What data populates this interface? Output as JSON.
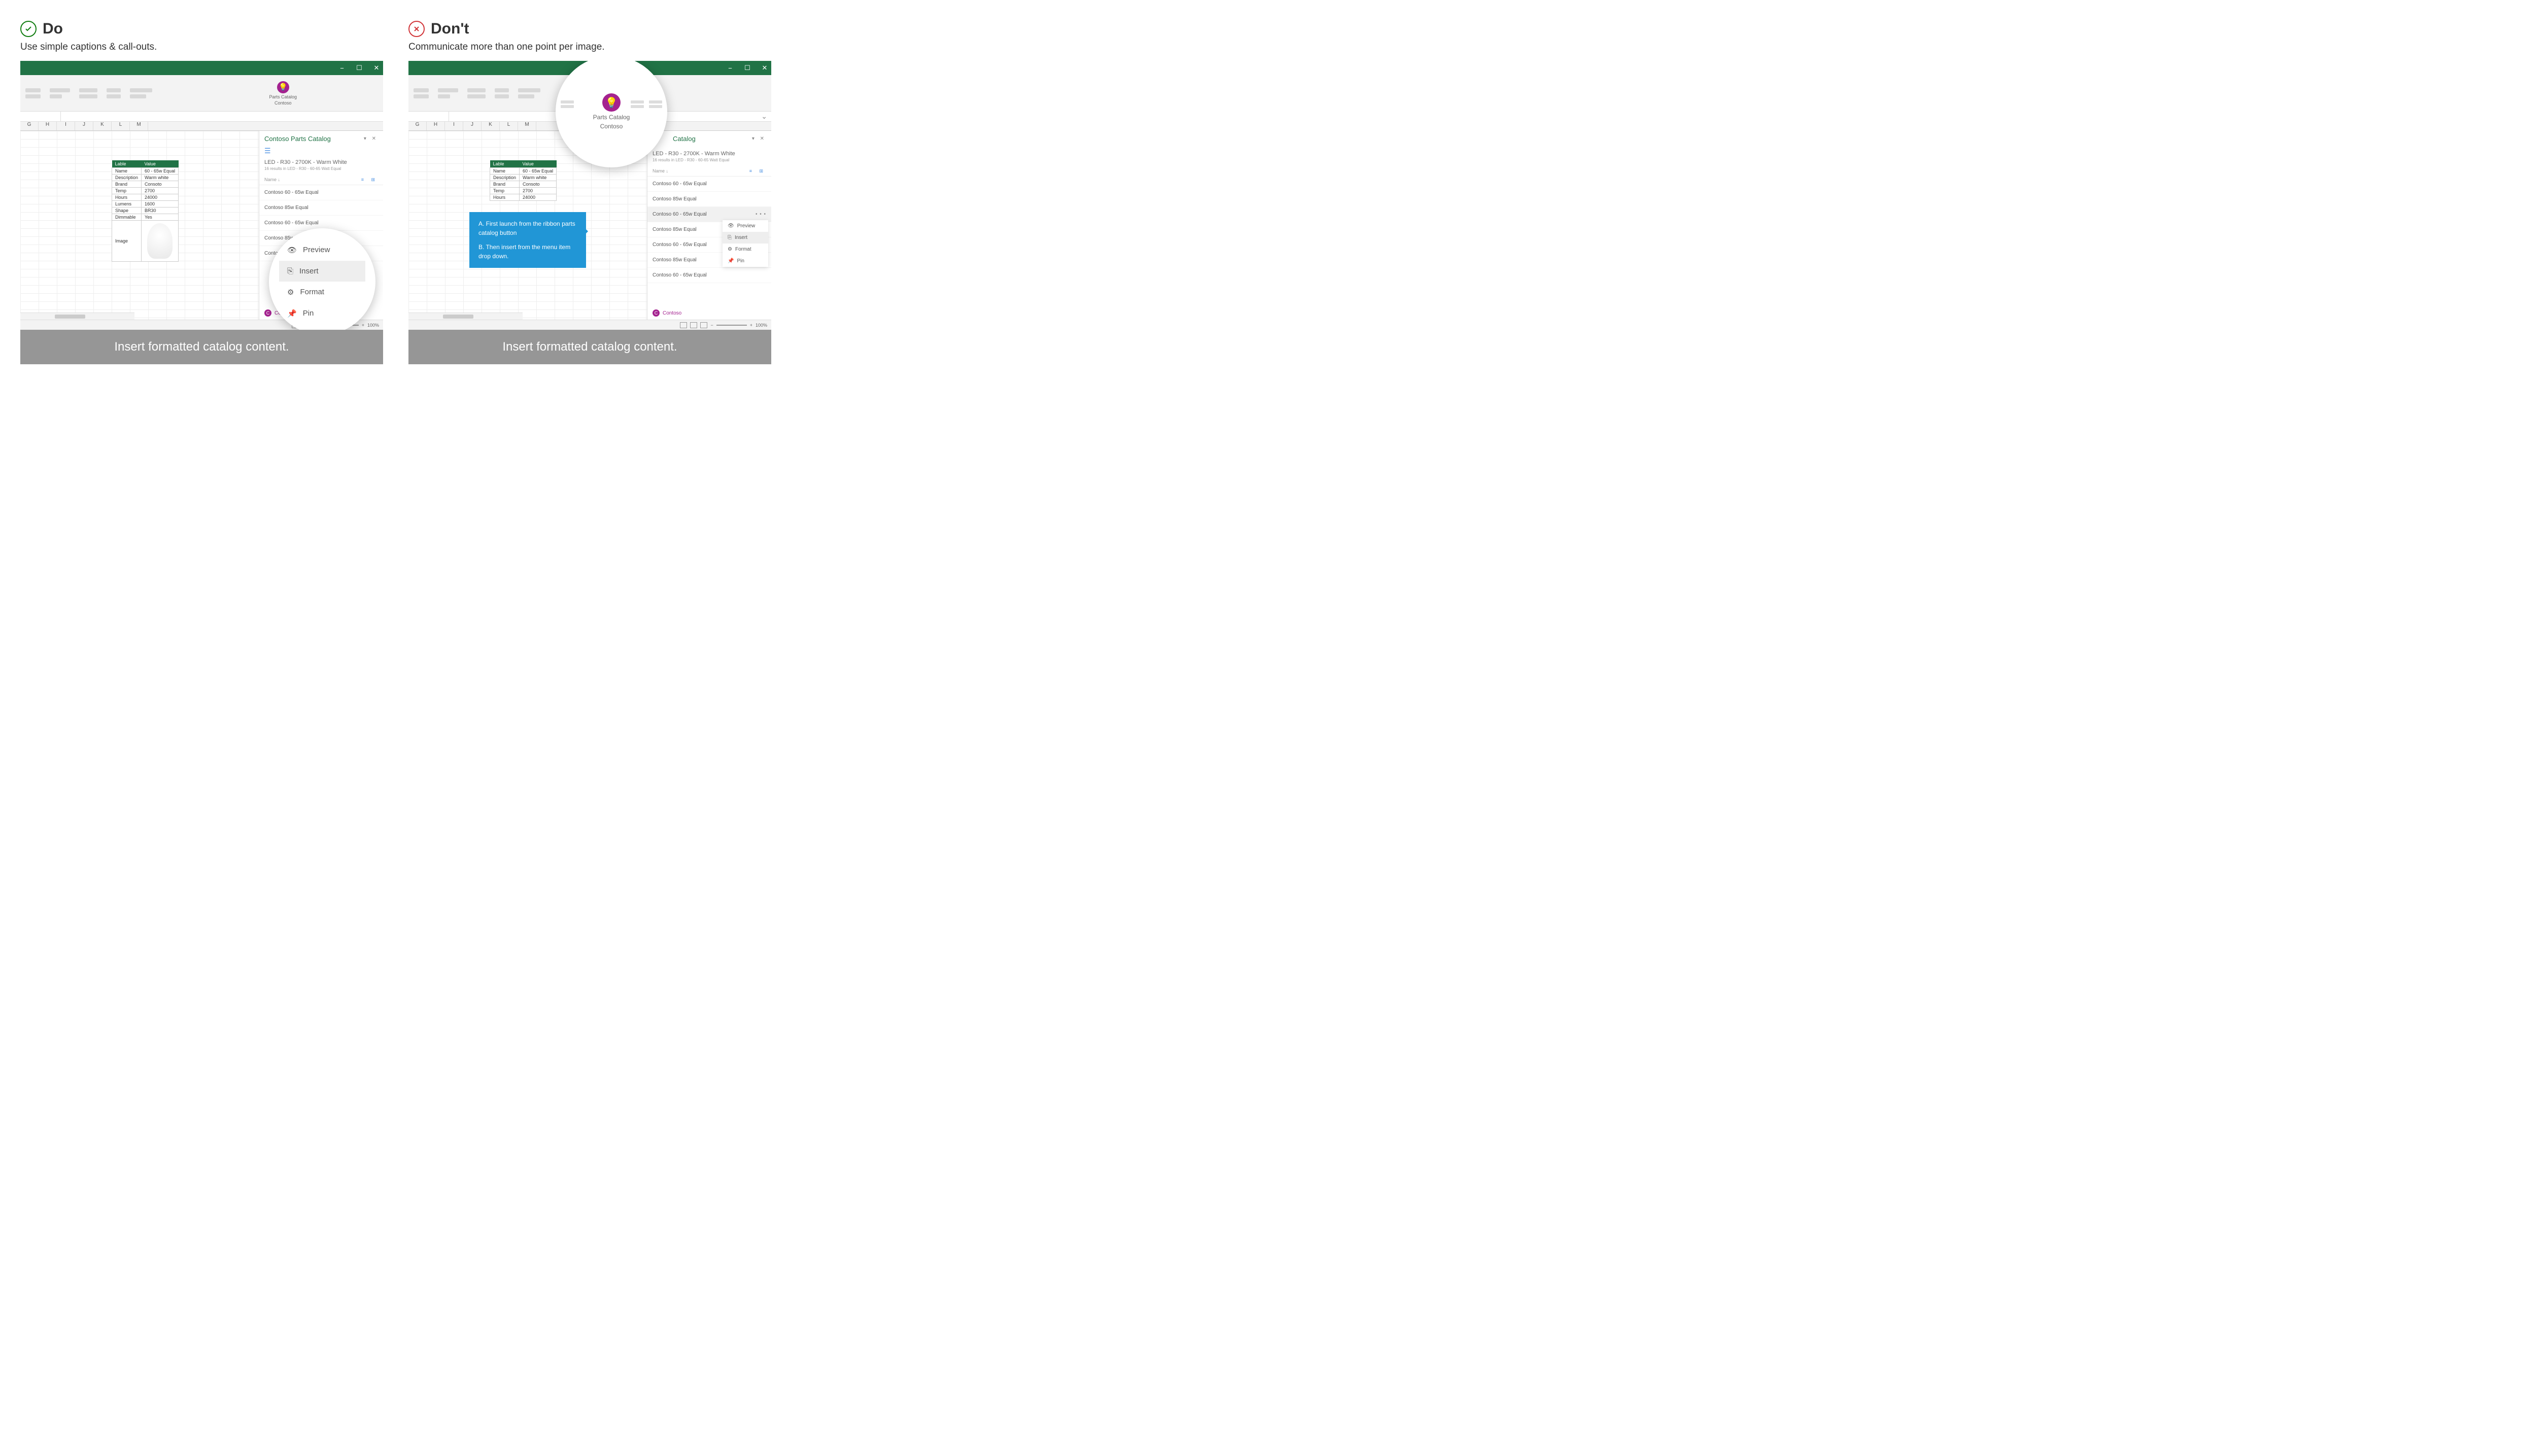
{
  "do": {
    "title": "Do",
    "subtitle": "Use simple captions & call-outs.",
    "caption": "Insert formatted catalog content."
  },
  "dont": {
    "title": "Don't",
    "subtitle": "Communicate more than one point per image.",
    "caption": "Insert formatted catalog content."
  },
  "ribbon": {
    "button_label1": "Parts Catalog",
    "button_label2": "Contoso"
  },
  "columns": [
    "G",
    "H",
    "I",
    "J",
    "K",
    "L",
    "M"
  ],
  "table": {
    "headers": [
      "Lable",
      "Value"
    ],
    "rows": [
      [
        "Name",
        "60 - 65w Equal"
      ],
      [
        "Description",
        "Warm white"
      ],
      [
        "Brand",
        "Consoto"
      ],
      [
        "Temp",
        "2700"
      ],
      [
        "Hours",
        "24000"
      ],
      [
        "Lumens",
        "1600"
      ],
      [
        "Shape",
        "BR30"
      ],
      [
        "Dimmable",
        "Yes"
      ],
      [
        "Image",
        ""
      ]
    ]
  },
  "pane": {
    "title": "Contoso Parts Catalog",
    "search_title": "LED - R30 - 2700K - Warm White",
    "search_sub": "16 results in LED - R30 - 60-65 Watt Equal",
    "sort": "Name",
    "items_do": [
      "Contoso 60 - 65w Equal",
      "Contoso 85w Equal",
      "Contoso 60 - 65w Equal",
      "Contoso 85w Equal",
      "Contoso 60 - 65w Equal"
    ],
    "items_dont": [
      "Contoso 60 - 65w Equal",
      "Contoso 85w Equal",
      "Contoso 60 - 65w Equal",
      "Contoso 85w Equal",
      "Contoso 60 - 65w Equal",
      "Contoso 85w Equal",
      "Contoso 60 - 65w Equal"
    ],
    "footer": "Contoso",
    "avatar": "C"
  },
  "menu": {
    "preview": "Preview",
    "insert": "Insert",
    "format": "Format",
    "pin": "Pin"
  },
  "callout": {
    "a": "A.  First launch from the ribbon parts catalog button",
    "b": "B.  Then insert from the menu item drop down."
  },
  "status": {
    "zoom": "100%"
  },
  "win": {
    "min": "−",
    "max": "☐",
    "close": "✕"
  }
}
